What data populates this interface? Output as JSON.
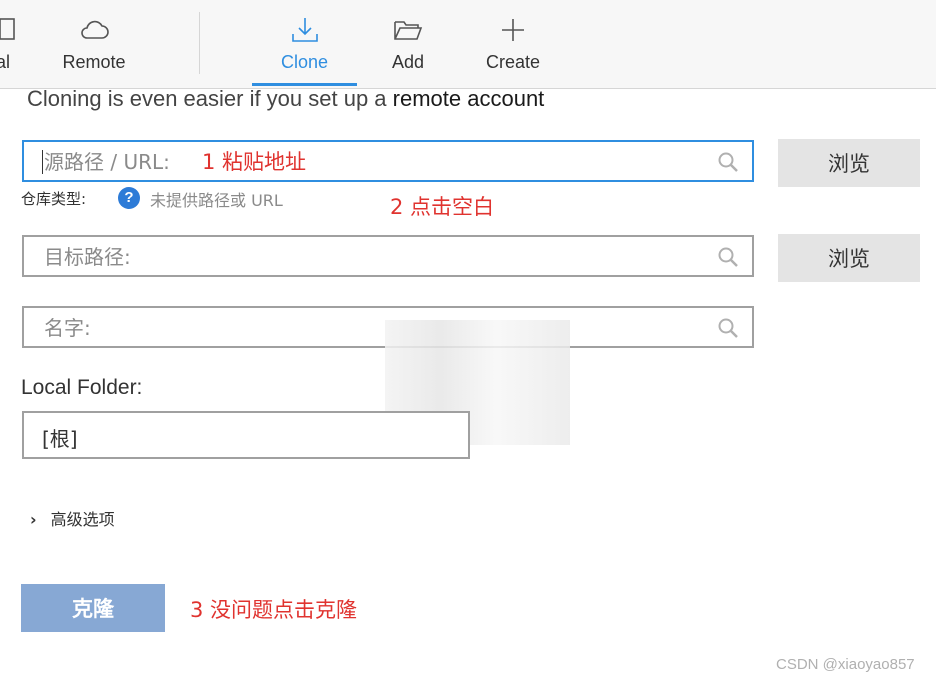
{
  "toolbar": {
    "items": [
      {
        "label": "al"
      },
      {
        "label": "Remote"
      },
      {
        "label": "Clone"
      },
      {
        "label": "Add"
      },
      {
        "label": "Create"
      }
    ],
    "active": "Clone",
    "accent": "#2f8ee0"
  },
  "hint": {
    "prefix": "Cloning is even easier if you set up a ",
    "link": "remote account"
  },
  "source": {
    "placeholder": "源路径 / URL:",
    "browse_label": "浏览"
  },
  "repo_type": {
    "label": "仓库类型:",
    "status": "未提供路径或 URL"
  },
  "target": {
    "placeholder": "目标路径:",
    "browse_label": "浏览"
  },
  "name": {
    "placeholder": "名字:"
  },
  "local_folder": {
    "label": "Local Folder:",
    "value": "[根]"
  },
  "advanced": {
    "label": "高级选项"
  },
  "clone_button": {
    "label": "克隆",
    "color": "#87a8d4"
  },
  "annotations": {
    "step1": "1 粘贴地址",
    "step2": "2 点击空白",
    "step3": "3 没问题点击克隆",
    "color": "#e0332f"
  },
  "watermark": "CSDN @xiaoyao857"
}
